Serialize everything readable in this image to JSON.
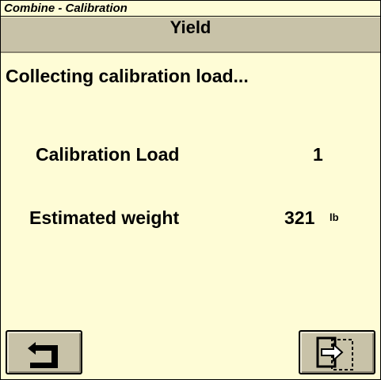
{
  "window": {
    "title": "Combine - Calibration"
  },
  "header": {
    "title": "Yield"
  },
  "main": {
    "status": "Collecting calibration load...",
    "calibration_load": {
      "label": "Calibration Load",
      "value": "1"
    },
    "estimated_weight": {
      "label": "Estimated weight",
      "value": "321",
      "unit": "lb"
    }
  },
  "buttons": {
    "back": {
      "icon": "return-arrow-icon"
    },
    "next": {
      "icon": "exit-to-page-icon"
    }
  },
  "colors": {
    "background": "#fefcd6",
    "header_bar": "#c8c2a8",
    "button": "#c8c2a8",
    "text": "#000000"
  }
}
